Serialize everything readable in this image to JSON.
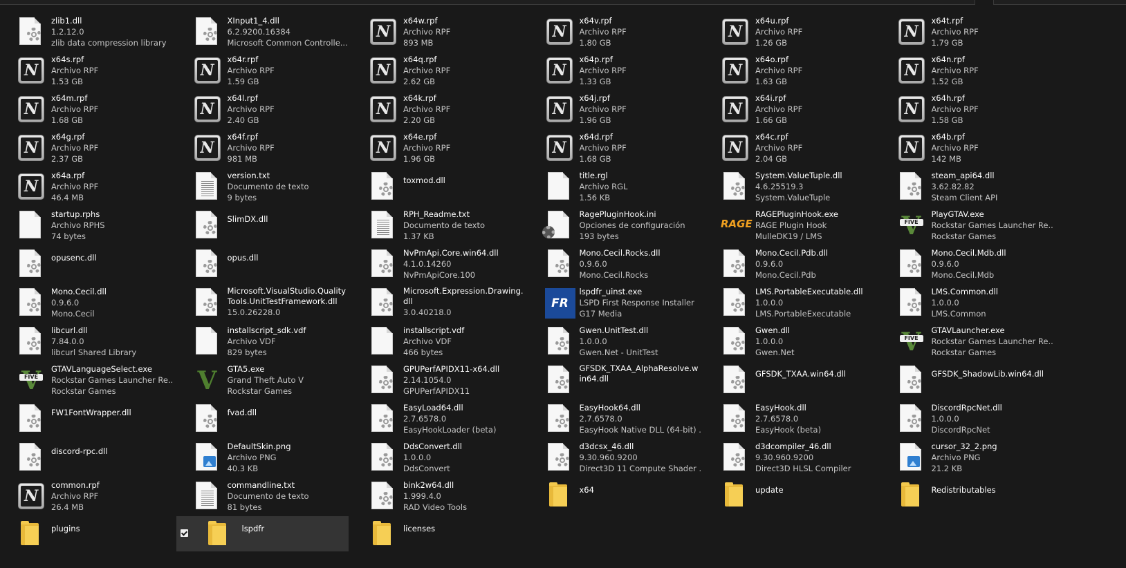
{
  "address_bar": {
    "path": "..."
  },
  "items": [
    {
      "icon": "dll-icon",
      "name": "zlib1.dll",
      "line2": "1.2.12.0",
      "line3": "zlib data compression library"
    },
    {
      "icon": "dll-icon",
      "name": "XInput1_4.dll",
      "line2": "6.2.9200.16384",
      "line3": "Microsoft Common Controlle..."
    },
    {
      "icon": "rpf-icon",
      "name": "x64w.rpf",
      "line2": "Archivo RPF",
      "line3": "893 MB"
    },
    {
      "icon": "rpf-icon",
      "name": "x64v.rpf",
      "line2": "Archivo RPF",
      "line3": "1.80 GB"
    },
    {
      "icon": "rpf-icon",
      "name": "x64u.rpf",
      "line2": "Archivo RPF",
      "line3": "1.26 GB"
    },
    {
      "icon": "rpf-icon",
      "name": "x64t.rpf",
      "line2": "Archivo RPF",
      "line3": "1.79 GB"
    },
    {
      "icon": "rpf-icon",
      "name": "x64s.rpf",
      "line2": "Archivo RPF",
      "line3": "1.53 GB"
    },
    {
      "icon": "rpf-icon",
      "name": "x64r.rpf",
      "line2": "Archivo RPF",
      "line3": "1.59 GB"
    },
    {
      "icon": "rpf-icon",
      "name": "x64q.rpf",
      "line2": "Archivo RPF",
      "line3": "2.62 GB"
    },
    {
      "icon": "rpf-icon",
      "name": "x64p.rpf",
      "line2": "Archivo RPF",
      "line3": "1.33 GB"
    },
    {
      "icon": "rpf-icon",
      "name": "x64o.rpf",
      "line2": "Archivo RPF",
      "line3": "1.63 GB"
    },
    {
      "icon": "rpf-icon",
      "name": "x64n.rpf",
      "line2": "Archivo RPF",
      "line3": "1.52 GB"
    },
    {
      "icon": "rpf-icon",
      "name": "x64m.rpf",
      "line2": "Archivo RPF",
      "line3": "1.68 GB"
    },
    {
      "icon": "rpf-icon",
      "name": "x64l.rpf",
      "line2": "Archivo RPF",
      "line3": "2.40 GB"
    },
    {
      "icon": "rpf-icon",
      "name": "x64k.rpf",
      "line2": "Archivo RPF",
      "line3": "2.20 GB"
    },
    {
      "icon": "rpf-icon",
      "name": "x64j.rpf",
      "line2": "Archivo RPF",
      "line3": "1.96 GB"
    },
    {
      "icon": "rpf-icon",
      "name": "x64i.rpf",
      "line2": "Archivo RPF",
      "line3": "1.66 GB"
    },
    {
      "icon": "rpf-icon",
      "name": "x64h.rpf",
      "line2": "Archivo RPF",
      "line3": "1.58 GB"
    },
    {
      "icon": "rpf-icon",
      "name": "x64g.rpf",
      "line2": "Archivo RPF",
      "line3": "2.37 GB"
    },
    {
      "icon": "rpf-icon",
      "name": "x64f.rpf",
      "line2": "Archivo RPF",
      "line3": "981 MB"
    },
    {
      "icon": "rpf-icon",
      "name": "x64e.rpf",
      "line2": "Archivo RPF",
      "line3": "1.96 GB"
    },
    {
      "icon": "rpf-icon",
      "name": "x64d.rpf",
      "line2": "Archivo RPF",
      "line3": "1.68 GB"
    },
    {
      "icon": "rpf-icon",
      "name": "x64c.rpf",
      "line2": "Archivo RPF",
      "line3": "2.04 GB"
    },
    {
      "icon": "rpf-icon",
      "name": "x64b.rpf",
      "line2": "Archivo RPF",
      "line3": "142 MB"
    },
    {
      "icon": "rpf-icon",
      "name": "x64a.rpf",
      "line2": "Archivo RPF",
      "line3": "46.4 MB"
    },
    {
      "icon": "text-file-icon",
      "name": "version.txt",
      "line2": "Documento de texto",
      "line3": "9 bytes"
    },
    {
      "icon": "dll-icon",
      "name": "toxmod.dll",
      "line2": "",
      "line3": ""
    },
    {
      "icon": "blank-file-icon",
      "name": "title.rgl",
      "line2": "Archivo RGL",
      "line3": "1.56 KB"
    },
    {
      "icon": "dll-icon",
      "name": "System.ValueTuple.dll",
      "line2": "4.6.25519.3",
      "line3": "System.ValueTuple"
    },
    {
      "icon": "dll-icon",
      "name": "steam_api64.dll",
      "line2": "3.62.82.82",
      "line3": "Steam Client API"
    },
    {
      "icon": "blank-file-icon",
      "name": "startup.rphs",
      "line2": "Archivo RPHS",
      "line3": "74 bytes"
    },
    {
      "icon": "dll-icon",
      "name": "SlimDX.dll",
      "line2": "",
      "line3": ""
    },
    {
      "icon": "text-file-icon",
      "name": "RPH_Readme.txt",
      "line2": "Documento de texto",
      "line3": "1.37 KB"
    },
    {
      "icon": "ini-icon",
      "name": "RagePluginHook.ini",
      "line2": "Opciones de configuración",
      "line3": "193 bytes"
    },
    {
      "icon": "rage-icon",
      "name": "RAGEPluginHook.exe",
      "line2": "RAGE Plugin Hook",
      "line3": "MulleDK19 / LMS"
    },
    {
      "icon": "gtav-icon",
      "name": "PlayGTAV.exe",
      "line2": "Rockstar Games Launcher Re...",
      "line3": "Rockstar Games"
    },
    {
      "icon": "dll-icon",
      "name": "opusenc.dll",
      "line2": "",
      "line3": ""
    },
    {
      "icon": "dll-icon",
      "name": "opus.dll",
      "line2": "",
      "line3": ""
    },
    {
      "icon": "dll-icon",
      "name": "NvPmApi.Core.win64.dll",
      "line2": "4.1.0.14260",
      "line3": "NvPmApiCore.100"
    },
    {
      "icon": "dll-icon",
      "name": "Mono.Cecil.Rocks.dll",
      "line2": "0.9.6.0",
      "line3": "Mono.Cecil.Rocks"
    },
    {
      "icon": "dll-icon",
      "name": "Mono.Cecil.Pdb.dll",
      "line2": "0.9.6.0",
      "line3": "Mono.Cecil.Pdb"
    },
    {
      "icon": "dll-icon",
      "name": "Mono.Cecil.Mdb.dll",
      "line2": "0.9.6.0",
      "line3": "Mono.Cecil.Mdb"
    },
    {
      "icon": "dll-icon",
      "name": "Mono.Cecil.dll",
      "line2": "0.9.6.0",
      "line3": "Mono.Cecil"
    },
    {
      "icon": "dll-icon",
      "name": "Microsoft.VisualStudio.QualityTools.UnitTestFramework.dll",
      "line2": "15.0.26228.0",
      "line3": "",
      "wrap": true
    },
    {
      "icon": "dll-icon",
      "name": "Microsoft.Expression.Drawing.dll",
      "line2": "3.0.40218.0",
      "line3": "",
      "wrap": true
    },
    {
      "icon": "lspdfr-icon",
      "name": "lspdfr_uinst.exe",
      "line2": "LSPD First Response Installer",
      "line3": "G17 Media"
    },
    {
      "icon": "dll-icon",
      "name": "LMS.PortableExecutable.dll",
      "line2": "1.0.0.0",
      "line3": "LMS.PortableExecutable"
    },
    {
      "icon": "dll-icon",
      "name": "LMS.Common.dll",
      "line2": "1.0.0.0",
      "line3": "LMS.Common"
    },
    {
      "icon": "dll-icon",
      "name": "libcurl.dll",
      "line2": "7.84.0.0",
      "line3": "libcurl Shared Library"
    },
    {
      "icon": "blank-file-icon",
      "name": "installscript_sdk.vdf",
      "line2": "Archivo VDF",
      "line3": "829 bytes"
    },
    {
      "icon": "blank-file-icon",
      "name": "installscript.vdf",
      "line2": "Archivo VDF",
      "line3": "466 bytes"
    },
    {
      "icon": "dll-icon",
      "name": "Gwen.UnitTest.dll",
      "line2": "1.0.0.0",
      "line3": "Gwen.Net - UnitTest"
    },
    {
      "icon": "dll-icon",
      "name": "Gwen.dll",
      "line2": "1.0.0.0",
      "line3": "Gwen.Net"
    },
    {
      "icon": "gtav-icon",
      "name": "GTAVLauncher.exe",
      "line2": "Rockstar Games Launcher Re...",
      "line3": "Rockstar Games"
    },
    {
      "icon": "gtav-icon",
      "name": "GTAVLanguageSelect.exe",
      "line2": "Rockstar Games Launcher Re...",
      "line3": "Rockstar Games"
    },
    {
      "icon": "gta5-icon",
      "name": "GTA5.exe",
      "line2": "Grand Theft Auto V",
      "line3": "Rockstar Games"
    },
    {
      "icon": "dll-icon",
      "name": "GPUPerfAPIDX11-x64.dll",
      "line2": "2.14.1054.0",
      "line3": "GPUPerfAPIDX11"
    },
    {
      "icon": "dll-icon",
      "name": "GFSDK_TXAA_AlphaResolve.win64.dll",
      "line2": "",
      "line3": "",
      "wrap": true
    },
    {
      "icon": "dll-icon",
      "name": "GFSDK_TXAA.win64.dll",
      "line2": "",
      "line3": ""
    },
    {
      "icon": "dll-icon",
      "name": "GFSDK_ShadowLib.win64.dll",
      "line2": "",
      "line3": ""
    },
    {
      "icon": "dll-icon",
      "name": "FW1FontWrapper.dll",
      "line2": "",
      "line3": ""
    },
    {
      "icon": "dll-icon",
      "name": "fvad.dll",
      "line2": "",
      "line3": ""
    },
    {
      "icon": "dll-icon",
      "name": "EasyLoad64.dll",
      "line2": "2.7.6578.0",
      "line3": "EasyHookLoader (beta)"
    },
    {
      "icon": "dll-icon",
      "name": "EasyHook64.dll",
      "line2": "2.7.6578.0",
      "line3": "EasyHook Native DLL (64-bit) ..."
    },
    {
      "icon": "dll-icon",
      "name": "EasyHook.dll",
      "line2": "2.7.6578.0",
      "line3": "EasyHook (beta)"
    },
    {
      "icon": "dll-icon",
      "name": "DiscordRpcNet.dll",
      "line2": "1.0.0.0",
      "line3": "DiscordRpcNet"
    },
    {
      "icon": "dll-icon",
      "name": "discord-rpc.dll",
      "line2": "",
      "line3": ""
    },
    {
      "icon": "png-icon",
      "name": "DefaultSkin.png",
      "line2": "Archivo PNG",
      "line3": "40.3 KB"
    },
    {
      "icon": "dll-icon",
      "name": "DdsConvert.dll",
      "line2": "1.0.0.0",
      "line3": "DdsConvert"
    },
    {
      "icon": "dll-icon",
      "name": "d3dcsx_46.dll",
      "line2": "9.30.960.9200",
      "line3": "Direct3D 11 Compute Shader ..."
    },
    {
      "icon": "dll-icon",
      "name": "d3dcompiler_46.dll",
      "line2": "9.30.960.9200",
      "line3": "Direct3D HLSL Compiler"
    },
    {
      "icon": "png-icon",
      "name": "cursor_32_2.png",
      "line2": "Archivo PNG",
      "line3": "21.2 KB"
    },
    {
      "icon": "rpf-icon",
      "name": "common.rpf",
      "line2": "Archivo RPF",
      "line3": "26.4 MB"
    },
    {
      "icon": "text-file-icon",
      "name": "commandline.txt",
      "line2": "Documento de texto",
      "line3": "81 bytes"
    },
    {
      "icon": "dll-icon",
      "name": "bink2w64.dll",
      "line2": "1.999.4.0",
      "line3": "RAD Video Tools"
    },
    {
      "icon": "folder-icon",
      "name": "x64",
      "line2": "",
      "line3": ""
    },
    {
      "icon": "folder-icon",
      "name": "update",
      "line2": "",
      "line3": ""
    },
    {
      "icon": "folder-icon",
      "name": "Redistributables",
      "line2": "",
      "line3": ""
    },
    {
      "icon": "folder-icon",
      "name": "plugins",
      "line2": "",
      "line3": ""
    },
    {
      "icon": "folder-icon",
      "name": "lspdfr",
      "line2": "",
      "line3": "",
      "selected": true
    },
    {
      "icon": "folder-icon",
      "name": "licenses",
      "line2": "",
      "line3": ""
    }
  ],
  "icon_glyphs": {
    "rpf_letter": "N",
    "rage_text": "RAGE",
    "lspdfr_text": "FR",
    "gtav_badge": "FIVE",
    "gta5_letter": "V"
  }
}
